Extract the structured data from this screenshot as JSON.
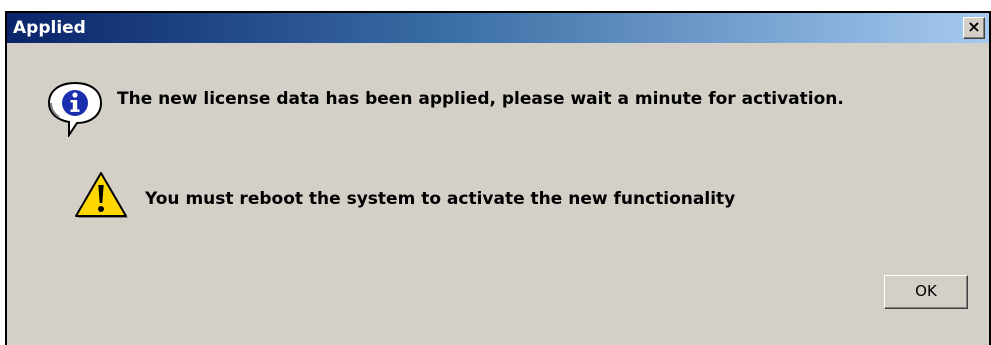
{
  "dialog": {
    "title": "Applied",
    "close_label": "×",
    "info_message": "The new license data has been applied, please wait a minute for activation.",
    "warning_message": "You must reboot the system to activate the new functionality",
    "ok_label": "OK"
  },
  "icons": {
    "info": "info-icon",
    "warning": "warning-icon",
    "close": "close-icon"
  },
  "colors": {
    "titlebar_start": "#0a246a",
    "titlebar_end": "#a6caf0",
    "dialog_bg": "#d4d0c8",
    "warning_yellow": "#ffd700",
    "info_blue": "#1a2fb0"
  }
}
